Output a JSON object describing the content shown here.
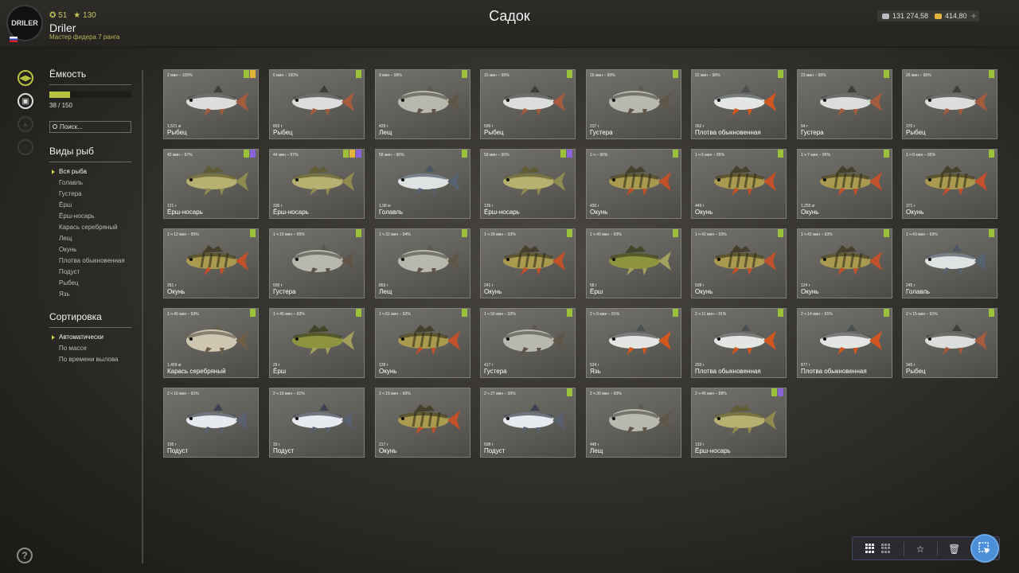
{
  "header": {
    "title": "Садок",
    "logo_text": "DRILER",
    "player": {
      "level": "51",
      "stars": "130",
      "name": "Driler",
      "rank": "Мастер фидера 7 ранга"
    },
    "silver": "131 274,58",
    "gold": "414,80",
    "plus_label": "+"
  },
  "capacity": {
    "label": "Ёмкость",
    "value": "38 / 150",
    "fill_fraction": 0.2533,
    "search_placeholder": "Поиск..."
  },
  "species": {
    "label": "Виды рыб",
    "items": [
      "Вся рыба",
      "Голавль",
      "Густера",
      "Ёрш",
      "Ёрш-носарь",
      "Карась серебряный",
      "Лещ",
      "Окунь",
      "Плотва обыкновенная",
      "Подуст",
      "Рыбец",
      "Язь"
    ]
  },
  "sorting": {
    "label": "Сортировка",
    "items": [
      "Автоматически",
      "По массе",
      "По времени вылова"
    ]
  },
  "help": "?",
  "fish": [
    {
      "time": "2 мин – 100%",
      "weight": "1,521 кг",
      "name": "Рыбец",
      "tags": [
        "green",
        "yellow"
      ],
      "kind": "silver"
    },
    {
      "time": "6 мин – 100%",
      "weight": "803 г",
      "name": "Рыбец",
      "tags": [
        "green"
      ],
      "kind": "silver"
    },
    {
      "time": "9 мин – 99%",
      "weight": "429 г",
      "name": "Лещ",
      "tags": [
        "green"
      ],
      "kind": "bream"
    },
    {
      "time": "15 мин – 99%",
      "weight": "596 г",
      "name": "Рыбец",
      "tags": [
        "green"
      ],
      "kind": "silver"
    },
    {
      "time": "16 мин – 99%",
      "weight": "237 г",
      "name": "Густера",
      "tags": [
        "green"
      ],
      "kind": "bream"
    },
    {
      "time": "22 мин – 98%",
      "weight": "352 г",
      "name": "Плотва обыкновенная",
      "tags": [
        "green"
      ],
      "kind": "roach"
    },
    {
      "time": "23 мин – 98%",
      "weight": "64 г",
      "name": "Густера",
      "tags": [
        "green"
      ],
      "kind": "silver"
    },
    {
      "time": "26 мин – 98%",
      "weight": "370 г",
      "name": "Рыбец",
      "tags": [
        "green"
      ],
      "kind": "silver"
    },
    {
      "time": "42 мин – 97%",
      "weight": "121 г",
      "name": "Ёрш-носарь",
      "tags": [
        "green",
        "purple"
      ],
      "kind": "ruffe"
    },
    {
      "time": "44 мин – 97%",
      "weight": "336 г",
      "name": "Ёрш-носарь",
      "tags": [
        "green",
        "yellow",
        "purple"
      ],
      "kind": "ruffe"
    },
    {
      "time": "58 мин – 96%",
      "weight": "1,98 кг",
      "name": "Голавль",
      "tags": [
        "green"
      ],
      "kind": "chub"
    },
    {
      "time": "59 мин – 96%",
      "weight": "139 г",
      "name": "Ёрш-носарь",
      "tags": [
        "green",
        "purple"
      ],
      "kind": "ruffe"
    },
    {
      "time": "1 ч – 96%",
      "weight": "430 г",
      "name": "Окунь",
      "tags": [
        "green"
      ],
      "kind": "perch"
    },
    {
      "time": "1 ч 6 мин – 95%",
      "weight": "449 г",
      "name": "Окунь",
      "tags": [
        "green"
      ],
      "kind": "perch"
    },
    {
      "time": "1 ч 7 мин – 95%",
      "weight": "1,255 кг",
      "name": "Окунь",
      "tags": [
        "green"
      ],
      "kind": "perch"
    },
    {
      "time": "1 ч 8 мин – 95%",
      "weight": "371 г",
      "name": "Окунь",
      "tags": [
        "green"
      ],
      "kind": "perch"
    },
    {
      "time": "1 ч 12 мин – 95%",
      "weight": "261 г",
      "name": "Окунь",
      "tags": [
        "green"
      ],
      "kind": "perch"
    },
    {
      "time": "1 ч 15 мин – 95%",
      "weight": "500 г",
      "name": "Густера",
      "tags": [
        "green"
      ],
      "kind": "bream"
    },
    {
      "time": "1 ч 32 мин – 94%",
      "weight": "853 г",
      "name": "Лещ",
      "tags": [
        "green"
      ],
      "kind": "bream"
    },
    {
      "time": "1 ч 39 мин – 93%",
      "weight": "241 г",
      "name": "Окунь",
      "tags": [
        "green"
      ],
      "kind": "perch"
    },
    {
      "time": "1 ч 40 мин – 93%",
      "weight": "58 г",
      "name": "Ёрш",
      "tags": [
        "green"
      ],
      "kind": "ruff"
    },
    {
      "time": "1 ч 42 мин – 93%",
      "weight": "508 г",
      "name": "Окунь",
      "tags": [
        "green"
      ],
      "kind": "perch"
    },
    {
      "time": "1 ч 42 мин – 93%",
      "weight": "124 г",
      "name": "Окунь",
      "tags": [
        "green"
      ],
      "kind": "perch"
    },
    {
      "time": "1 ч 43 мин – 93%",
      "weight": "245 г",
      "name": "Голавль",
      "tags": [
        "green"
      ],
      "kind": "chub"
    },
    {
      "time": "1 ч 45 мин – 93%",
      "weight": "1,459 кг",
      "name": "Карась серебряный",
      "tags": [
        "green"
      ],
      "kind": "carp"
    },
    {
      "time": "1 ч 46 мин – 93%",
      "weight": "25 г",
      "name": "Ёрш",
      "tags": [
        "green"
      ],
      "kind": "ruff"
    },
    {
      "time": "1 ч 51 мин – 92%",
      "weight": "128 г",
      "name": "Окунь",
      "tags": [
        "green"
      ],
      "kind": "perch"
    },
    {
      "time": "1 ч 56 мин – 92%",
      "weight": "417 г",
      "name": "Густера",
      "tags": [
        "green"
      ],
      "kind": "bream"
    },
    {
      "time": "2 ч 9 мин – 91%",
      "weight": "524 г",
      "name": "Язь",
      "tags": [
        "green"
      ],
      "kind": "roach"
    },
    {
      "time": "2 ч 11 мин – 91%",
      "weight": "203 г",
      "name": "Плотва обыкновенная",
      "tags": [
        "green"
      ],
      "kind": "roach"
    },
    {
      "time": "2 ч 14 мин – 91%",
      "weight": "877 г",
      "name": "Плотва обыкновенная",
      "tags": [
        "green"
      ],
      "kind": "roach"
    },
    {
      "time": "2 ч 15 мин – 91%",
      "weight": "345 г",
      "name": "Рыбец",
      "tags": [
        "green"
      ],
      "kind": "silver"
    },
    {
      "time": "2 ч 16 мин – 91%",
      "weight": "106 г",
      "name": "Подуст",
      "tags": [],
      "kind": "nase"
    },
    {
      "time": "2 ч 16 мин – 91%",
      "weight": "33 г",
      "name": "Подуст",
      "tags": [],
      "kind": "nase"
    },
    {
      "time": "2 ч 19 мин – 90%",
      "weight": "217 г",
      "name": "Окунь",
      "tags": [],
      "kind": "perch"
    },
    {
      "time": "2 ч 27 мин – 90%",
      "weight": "508 г",
      "name": "Подуст",
      "tags": [
        "green"
      ],
      "kind": "nase"
    },
    {
      "time": "2 ч 30 мин – 90%",
      "weight": "448 г",
      "name": "Лещ",
      "tags": [],
      "kind": "bream"
    },
    {
      "time": "2 ч 45 мин – 88%",
      "weight": "133 г",
      "name": "Ёрш-носарь",
      "tags": [
        "green",
        "purple"
      ],
      "kind": "ruffe"
    }
  ],
  "fish_colors": {
    "silver": {
      "body": "#dcdedb",
      "back": "#3b3f3a",
      "fin": "#a45b3e"
    },
    "bream": {
      "body": "#b9b8ae",
      "back": "#5a5850",
      "fin": "#5e5548"
    },
    "roach": {
      "body": "#e4e6e4",
      "back": "#4a5050",
      "fin": "#d2571f"
    },
    "ruffe": {
      "body": "#b6b071",
      "back": "#5e5a30",
      "fin": "#8e8a50"
    },
    "chub": {
      "body": "#dfe2e3",
      "back": "#4b5660",
      "fin": "#566270"
    },
    "perch": {
      "body": "#a99a50",
      "back": "#3e3a22",
      "fin": "#c2502a"
    },
    "ruff": {
      "body": "#8e9340",
      "back": "#3c4020",
      "fin": "#a3a05e"
    },
    "carp": {
      "body": "#cfc7b2",
      "back": "#6a6252",
      "fin": "#6e5e48"
    },
    "nase": {
      "body": "#e7eaee",
      "back": "#3d4250",
      "fin": "#5a6070"
    }
  },
  "toolbar": {
    "icons": [
      "grid-large-icon",
      "grid-small-icon",
      "star-icon",
      "trash-icon",
      "select-cursor-icon"
    ]
  }
}
